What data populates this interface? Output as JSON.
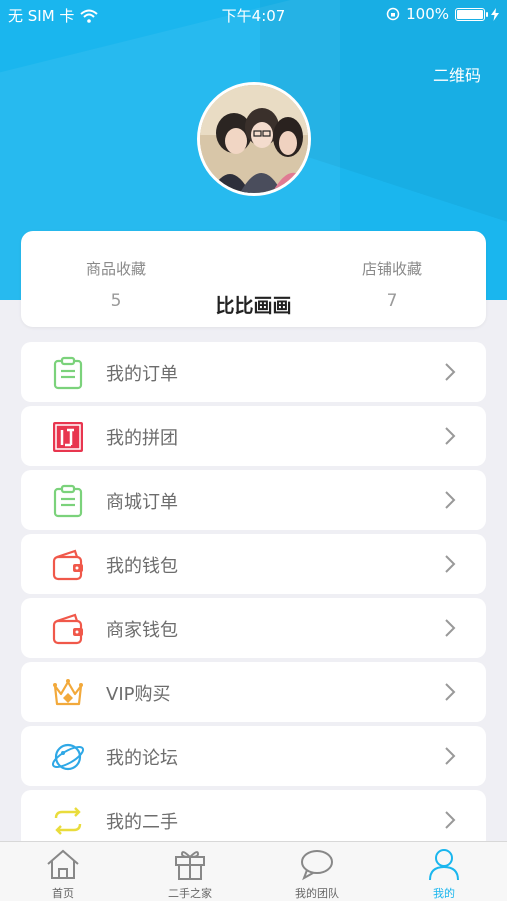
{
  "status_bar": {
    "carrier": "无 SIM 卡",
    "time": "下午4:07",
    "battery": "100%"
  },
  "header": {
    "qr_label": "二维码"
  },
  "profile": {
    "username": "比比画画",
    "stats": [
      {
        "label": "商品收藏",
        "value": "5"
      },
      {
        "label": "店铺收藏",
        "value": "7"
      }
    ]
  },
  "menu": [
    {
      "label": "我的订单",
      "icon": "clipboard-icon"
    },
    {
      "label": "我的拼团",
      "icon": "group-buy-icon"
    },
    {
      "label": "商城订单",
      "icon": "clipboard-icon"
    },
    {
      "label": "我的钱包",
      "icon": "wallet-icon"
    },
    {
      "label": "商家钱包",
      "icon": "wallet-icon"
    },
    {
      "label": "VIP购买",
      "icon": "crown-icon"
    },
    {
      "label": "我的论坛",
      "icon": "planet-icon"
    },
    {
      "label": "我的二手",
      "icon": "exchange-arrows-icon"
    }
  ],
  "tabs": [
    {
      "label": "首页",
      "icon": "home-icon"
    },
    {
      "label": "二手之家",
      "icon": "gift-icon"
    },
    {
      "label": "我的团队",
      "icon": "chat-bubble-icon"
    },
    {
      "label": "我的",
      "icon": "person-icon",
      "active": true
    }
  ],
  "colors": {
    "accent": "#1ab6ee",
    "clipboard": "#7bd27b",
    "group_buy": "#e8364f",
    "wallet": "#f0584a",
    "crown": "#f2a93b",
    "planet": "#2fa8e6",
    "exchange": "#e9dc3c"
  }
}
